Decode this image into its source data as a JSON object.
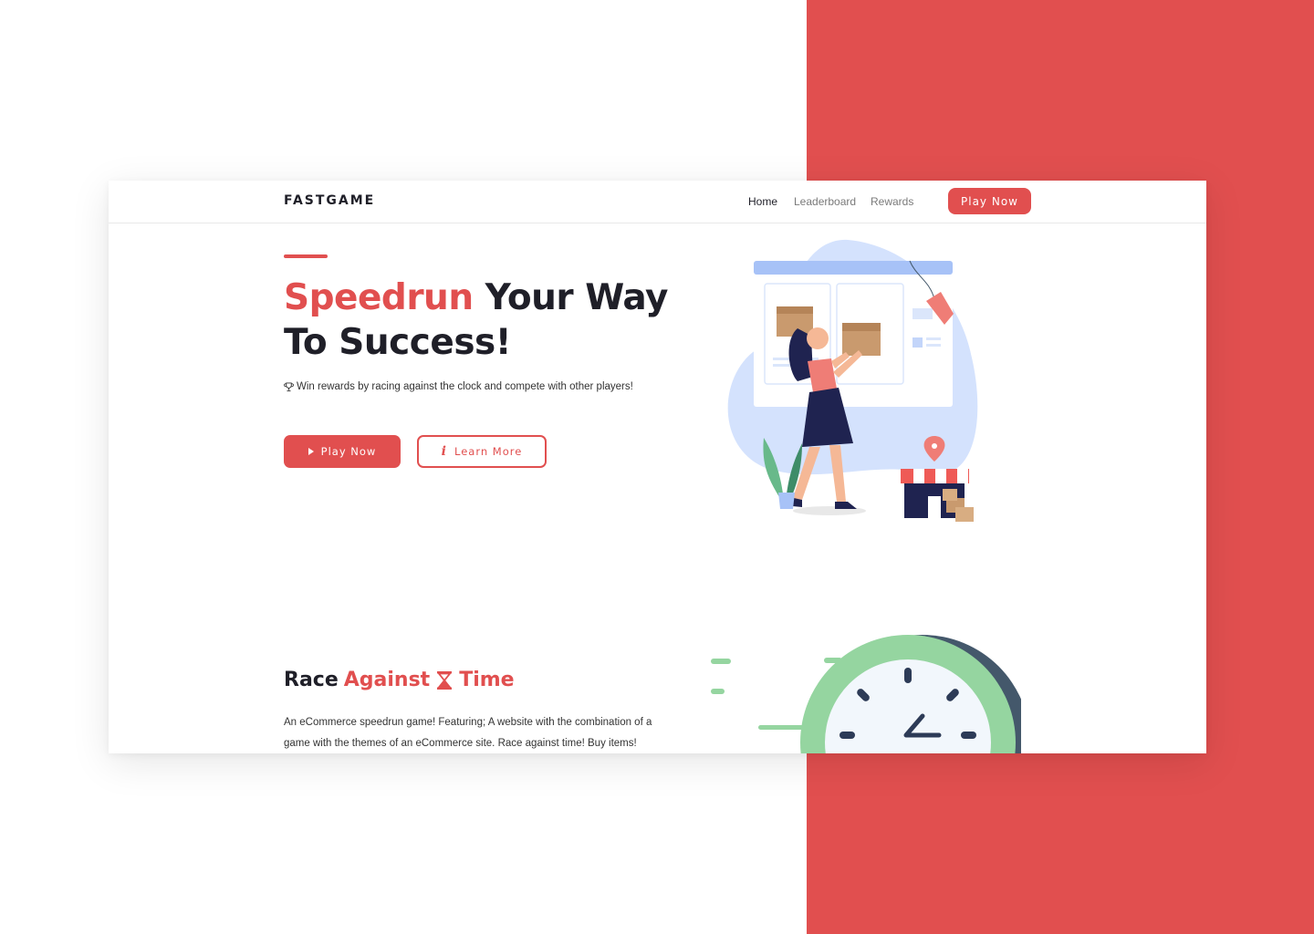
{
  "brand": {
    "name": "FASTGAME"
  },
  "nav": {
    "links": [
      {
        "label": "Home",
        "active": true
      },
      {
        "label": "Leaderboard",
        "active": false
      },
      {
        "label": "Rewards",
        "active": false
      }
    ],
    "cta_label": "Play Now"
  },
  "hero": {
    "title_highlight": "Speedrun",
    "title_rest": " Your Way To Success!",
    "subtitle": "Win rewards by racing against the clock and compete with other players!",
    "primary_button": "Play Now",
    "secondary_button": "Learn More",
    "info_glyph": "i"
  },
  "section": {
    "title_part1": "Race",
    "title_part2": "Against",
    "title_part3": "Time",
    "body": "An eCommerce speedrun game! Featuring; A website with the combination of a game with the themes of an eCommerce site. Race against time! Buy items!"
  },
  "colors": {
    "accent": "#e14f4f",
    "dark": "#1f1f28",
    "blob": "#d4e2fd",
    "clock_green": "#95d5a0",
    "clock_shadow": "#44586b"
  },
  "icons": [
    "trophy-icon",
    "play-icon",
    "info-icon",
    "hourglass-icon"
  ]
}
